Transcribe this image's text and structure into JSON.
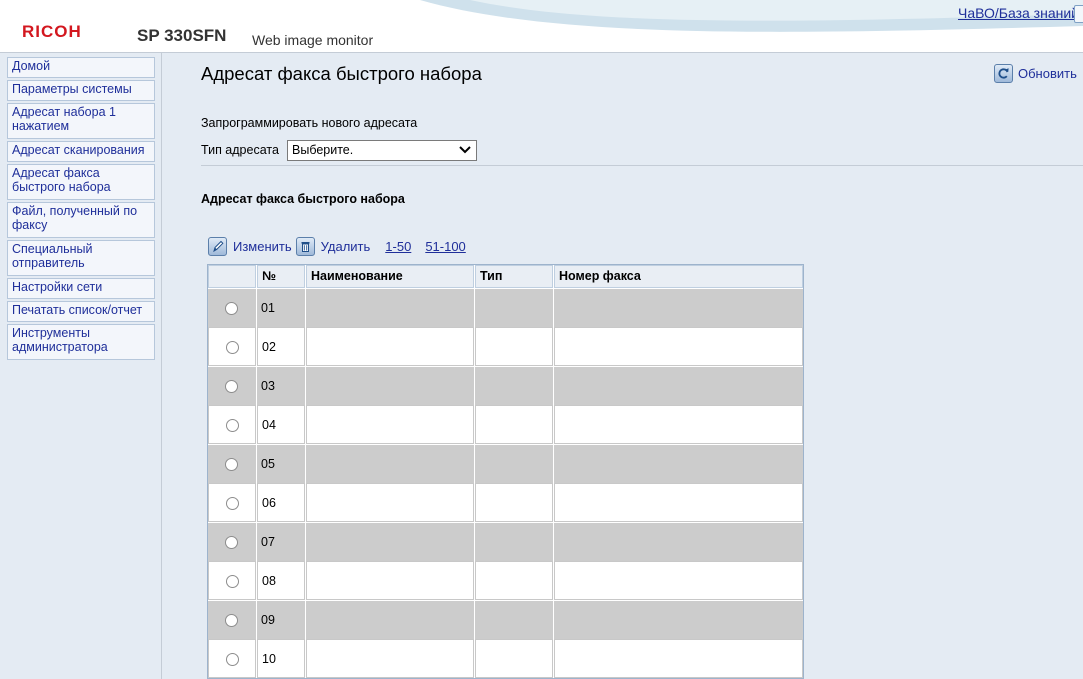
{
  "header": {
    "brand": "RICOH",
    "model": "SP 330SFN",
    "subtitle": "Web image monitor",
    "faq_link": "ЧаВО/База знаний"
  },
  "sidebar": {
    "items": [
      {
        "label": "Домой"
      },
      {
        "label": "Параметры системы"
      },
      {
        "label": "Адресат набора 1 нажатием"
      },
      {
        "label": "Адресат сканирования"
      },
      {
        "label": "Адресат факса быстрого набора"
      },
      {
        "label": "Файл, полученный по факсу"
      },
      {
        "label": "Специальный отправитель"
      },
      {
        "label": "Настройки сети"
      },
      {
        "label": "Печатать список/отчет"
      },
      {
        "label": "Инструменты администратора"
      }
    ]
  },
  "main": {
    "title": "Адресат факса быстрого набора",
    "refresh_label": "Обновить",
    "new_destination_label": "Запрограммировать нового адресата",
    "address_type_label": "Тип адресата",
    "address_type_value": "Выберите.",
    "section_title": "Адресат факса быстрого набора",
    "toolbar": {
      "edit_label": "Изменить",
      "delete_label": "Удалить",
      "pages": [
        "1-50",
        "51-100"
      ]
    },
    "table": {
      "headers": [
        "",
        "№",
        "Наименование",
        "Тип",
        "Номер факса"
      ],
      "rows": [
        {
          "no": "01",
          "name": "",
          "type": "",
          "fax": ""
        },
        {
          "no": "02",
          "name": "",
          "type": "",
          "fax": ""
        },
        {
          "no": "03",
          "name": "",
          "type": "",
          "fax": ""
        },
        {
          "no": "04",
          "name": "",
          "type": "",
          "fax": ""
        },
        {
          "no": "05",
          "name": "",
          "type": "",
          "fax": ""
        },
        {
          "no": "06",
          "name": "",
          "type": "",
          "fax": ""
        },
        {
          "no": "07",
          "name": "",
          "type": "",
          "fax": ""
        },
        {
          "no": "08",
          "name": "",
          "type": "",
          "fax": ""
        },
        {
          "no": "09",
          "name": "",
          "type": "",
          "fax": ""
        },
        {
          "no": "10",
          "name": "",
          "type": "",
          "fax": ""
        }
      ]
    }
  },
  "colors": {
    "brand_red": "#d3171f",
    "link_blue": "#1f2f9a",
    "background": "#e4ebf3",
    "row_shade": "#cccccc"
  },
  "icons": {
    "refresh": "refresh-icon",
    "edit": "pencil-icon",
    "delete": "trash-icon"
  }
}
